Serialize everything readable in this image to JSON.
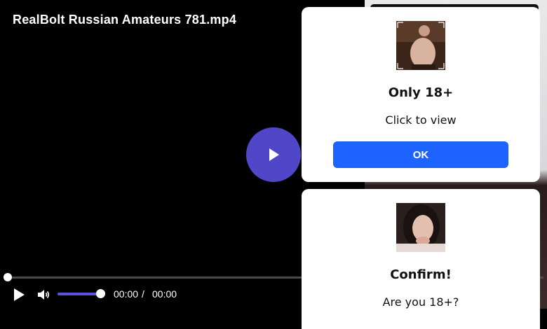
{
  "player": {
    "title": "RealBolt Russian Amateurs 781.mp4",
    "time_current": "00:00",
    "time_separator": "/",
    "time_total": "00:00",
    "progress": 0,
    "volume": 0.95,
    "accent_color": "#5046c8",
    "icons": {
      "big_play": "play-icon",
      "play": "play-icon",
      "volume": "volume-icon"
    }
  },
  "popups": [
    {
      "heading": "Only 18+",
      "text": "Click to view",
      "button_label": "OK",
      "button_color": "#1d63ff"
    },
    {
      "heading": "Confirm!",
      "text": "Are you 18+?"
    }
  ]
}
